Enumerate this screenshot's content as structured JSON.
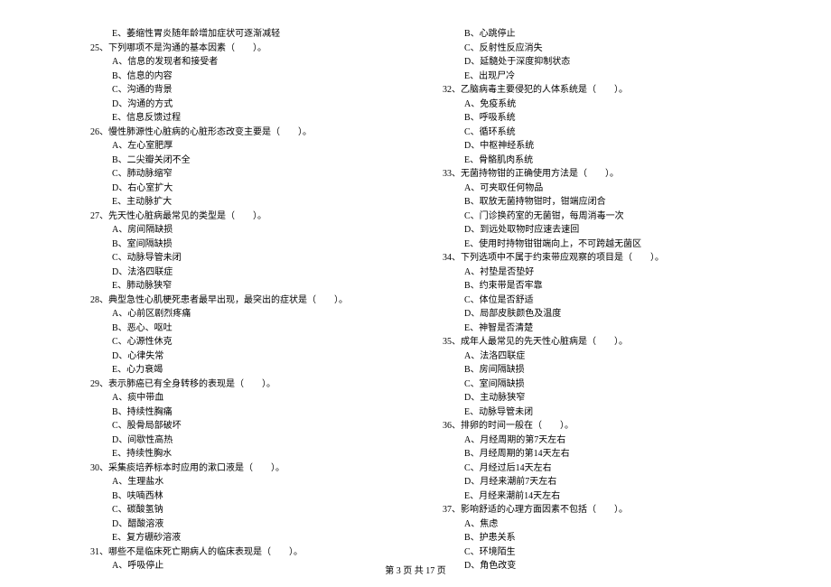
{
  "left": {
    "q24_optE": "E、萎缩性胃炎随年龄增加症状可逐渐减轻",
    "q25": {
      "text": "25、下列哪项不是沟通的基本因素（　　）。",
      "A": "A、信息的发现者和接受者",
      "B": "B、信息的内容",
      "C": "C、沟通的背景",
      "D": "D、沟通的方式",
      "E": "E、信息反馈过程"
    },
    "q26": {
      "text": "26、慢性肺源性心脏病的心脏形态改变主要是（　　）。",
      "A": "A、左心室肥厚",
      "B": "B、二尖瓣关闭不全",
      "C": "C、肺动脉缩窄",
      "D": "D、右心室扩大",
      "E": "E、主动脉扩大"
    },
    "q27": {
      "text": "27、先天性心脏病最常见的类型是（　　）。",
      "A": "A、房间隔缺损",
      "B": "B、室间隔缺损",
      "C": "C、动脉导管未闭",
      "D": "D、法洛四联症",
      "E": "E、肺动脉狭窄"
    },
    "q28": {
      "text": "28、典型急性心肌梗死患者最早出现，最突出的症状是（　　）。",
      "A": "A、心前区剧烈疼痛",
      "B": "B、恶心、呕吐",
      "C": "C、心源性休克",
      "D": "D、心律失常",
      "E": "E、心力衰竭"
    },
    "q29": {
      "text": "29、表示肺癌已有全身转移的表现是（　　）。",
      "A": "A、痰中带血",
      "B": "B、持续性胸痛",
      "C": "C、股骨局部破坏",
      "D": "D、间歇性高热",
      "E": "E、持续性胸水"
    },
    "q30": {
      "text": "30、采集痰培养标本时应用的漱口液是（　　）。",
      "A": "A、生理盐水",
      "B": "B、呋喃西林",
      "C": "C、碳酸氢钠",
      "D": "D、醋酸溶液",
      "E": "E、复方硼砂溶液"
    },
    "q31": {
      "text": "31、哪些不是临床死亡期病人的临床表现是（　　）。",
      "A": "A、呼吸停止"
    }
  },
  "right": {
    "q31_cont": {
      "B": "B、心跳停止",
      "C": "C、反射性反应消失",
      "D": "D、延髓处于深度抑制状态",
      "E": "E、出现尸冷"
    },
    "q32": {
      "text": "32、乙脑病毒主要侵犯的人体系统是（　　）。",
      "A": "A、免疫系统",
      "B": "B、呼吸系统",
      "C": "C、循环系统",
      "D": "D、中枢神经系统",
      "E": "E、骨骼肌肉系统"
    },
    "q33": {
      "text": "33、无菌持物钳的正确使用方法是（　　）。",
      "A": "A、可夹取任何物品",
      "B": "B、取放无菌持物钳时，钳端应闭合",
      "C": "C、门诊换药室的无菌钳，每周消毒一次",
      "D": "D、到远处取物时应速去速回",
      "E": "E、使用时持物钳钳端向上，不可跨越无菌区"
    },
    "q34": {
      "text": "34、下列选项中不属于约束带应观察的项目是（　　）。",
      "A": "A、衬垫是否垫好",
      "B": "B、约束带是否牢靠",
      "C": "C、体位是否舒适",
      "D": "D、局部皮肤颜色及温度",
      "E": "E、神智是否清楚"
    },
    "q35": {
      "text": "35、成年人最常见的先天性心脏病是（　　）。",
      "A": "A、法洛四联症",
      "B": "B、房间隔缺损",
      "C": "C、室间隔缺损",
      "D": "D、主动脉狭窄",
      "E": "E、动脉导管未闭"
    },
    "q36": {
      "text": "36、排卵的时间一般在（　　）。",
      "A": "A、月经周期的第7天左右",
      "B": "B、月经周期的第14天左右",
      "C": "C、月经过后14天左右",
      "D": "D、月经来潮前7天左右",
      "E": "E、月经来潮前14天左右"
    },
    "q37": {
      "text": "37、影响舒适的心理方面因素不包括（　　）。",
      "A": "A、焦虑",
      "B": "B、护患关系",
      "C": "C、环境陌生",
      "D": "D、角色改变"
    }
  },
  "footer": "第 3 页 共 17 页"
}
